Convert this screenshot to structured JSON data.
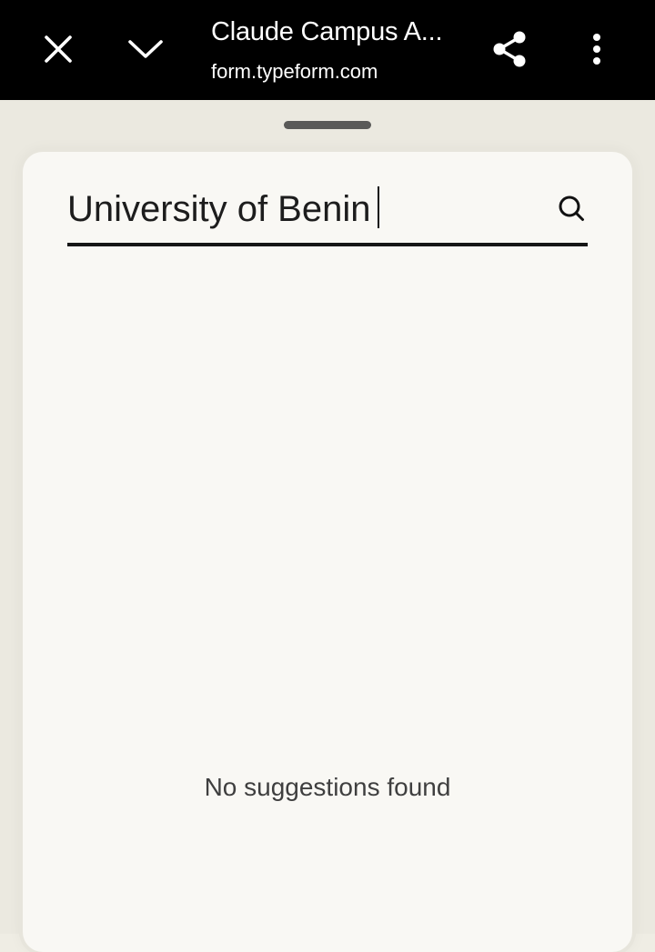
{
  "browser_bar": {
    "title": "Claude Campus A...",
    "url": "form.typeform.com",
    "icons": {
      "close": "close-icon",
      "collapse": "chevron-down-icon",
      "share": "share-icon",
      "menu": "more-vert-icon"
    }
  },
  "search": {
    "value": "University of Benin",
    "icon": "search-icon"
  },
  "results": {
    "empty_message": "No suggestions found"
  },
  "colors": {
    "topbar": "#000000",
    "card_background": "#f9f8f4",
    "page_background": "#efede4",
    "underline": "#161616"
  }
}
